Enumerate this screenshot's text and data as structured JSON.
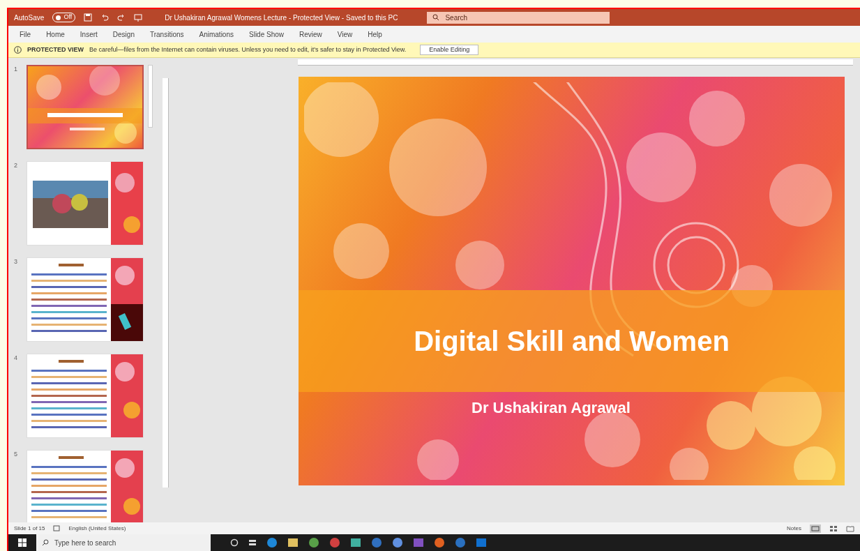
{
  "window": {
    "autosave_label": "AutoSave",
    "autosave_state": "Off",
    "autosave_on": false,
    "title": "Dr Ushakiran Agrawal Womens Lecture - Protected View - Saved to this PC",
    "search_placeholder": "Search"
  },
  "ribbon_tabs": [
    {
      "label": "File",
      "selected": false
    },
    {
      "label": "Home",
      "selected": false
    },
    {
      "label": "Insert",
      "selected": false
    },
    {
      "label": "Design",
      "selected": false
    },
    {
      "label": "Transitions",
      "selected": false
    },
    {
      "label": "Animations",
      "selected": false
    },
    {
      "label": "Slide Show",
      "selected": false
    },
    {
      "label": "Review",
      "selected": false
    },
    {
      "label": "View",
      "selected": false
    },
    {
      "label": "Help",
      "selected": false
    }
  ],
  "protected_bar": {
    "label": "PROTECTED VIEW",
    "message": "Be careful—files from the Internet can contain viruses. Unless you need to edit, it's safer to stay in Protected View.",
    "button": "Enable Editing"
  },
  "thumbnails": [
    {
      "number": "1",
      "kind": "title",
      "selected": true
    },
    {
      "number": "2",
      "kind": "photo",
      "selected": false
    },
    {
      "number": "3",
      "kind": "bullets_image",
      "selected": false
    },
    {
      "number": "4",
      "kind": "bullets",
      "selected": false
    },
    {
      "number": "5",
      "kind": "bullets",
      "selected": false
    }
  ],
  "slide": {
    "title": "Digital Skill and Women",
    "subtitle": "Dr Ushakiran Agrawal"
  },
  "status_bar": {
    "slide_info": "Slide 1 of 15",
    "language": "English (United States)",
    "notes": "Notes"
  },
  "taskbar": {
    "search_placeholder": "Type here to search"
  }
}
